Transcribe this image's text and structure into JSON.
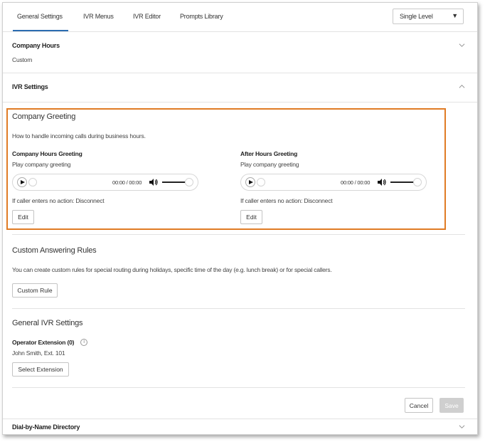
{
  "tabs": [
    {
      "label": "General Settings"
    },
    {
      "label": "IVR Menus"
    },
    {
      "label": "IVR Editor"
    },
    {
      "label": "Prompts Library"
    }
  ],
  "level_select": {
    "value": "Single Level"
  },
  "company_hours": {
    "title": "Company Hours",
    "value": "Custom"
  },
  "ivr_settings": {
    "title": "IVR Settings"
  },
  "company_greeting": {
    "title": "Company Greeting",
    "description": "How to handle incoming calls during business hours.",
    "hours_greeting": {
      "title": "Company Hours Greeting",
      "subtitle": "Play company greeting",
      "time": "00:00 / 00:00",
      "no_action": "If caller enters no action: Disconnect",
      "edit_label": "Edit"
    },
    "after_hours_greeting": {
      "title": "After Hours Greeting",
      "subtitle": "Play company greeting",
      "time": "00:00 / 00:00",
      "no_action": "If caller enters no action: Disconnect",
      "edit_label": "Edit"
    }
  },
  "custom_rules": {
    "title": "Custom Answering Rules",
    "description": "You can create custom rules for special routing during holidays, specific time of the day (e.g. lunch break) or for special callers.",
    "button_label": "Custom Rule"
  },
  "general_ivr": {
    "title": "General IVR Settings",
    "operator_label": "Operator Extension (0)",
    "operator_value": "John Smith, Ext. 101",
    "button_label": "Select Extension"
  },
  "footer": {
    "cancel_label": "Cancel",
    "save_label": "Save"
  },
  "dial_by_name": {
    "title": "Dial-by-Name Directory"
  },
  "colors": {
    "accent_box": "#e07b24",
    "tab_underline": "#2b6cb0"
  }
}
